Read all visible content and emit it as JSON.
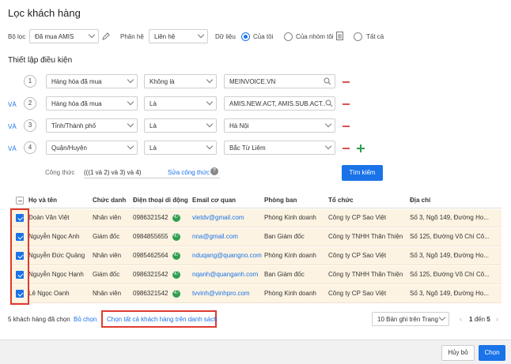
{
  "title": "Lọc khách hàng",
  "filter_row": {
    "filter_label": "Bộ lọc",
    "filter_value": "Đã mua AMIS",
    "module_label": "Phân hệ",
    "module_value": "Liên hệ",
    "data_label": "Dữ liệu",
    "radio_mine": "Của tôi",
    "radio_group": "Của nhóm tôi",
    "radio_all": "Tất cả"
  },
  "conditions_title": "Thiết lập điều kiện",
  "conditions": [
    {
      "num": "1",
      "join": "",
      "field": "Hàng hóa đã mua",
      "op": "Không là",
      "value": "MEINVOICE.VN"
    },
    {
      "num": "2",
      "join": "VÀ",
      "field": "Hàng hóa đã mua",
      "op": "Là",
      "value": "AMIS.NEW.ACT, AMIS.SUB.ACT..."
    },
    {
      "num": "3",
      "join": "VÀ",
      "field": "Tỉnh/Thành phố",
      "op": "Là",
      "value": "Hà Nội"
    },
    {
      "num": "4",
      "join": "VÀ",
      "field": "Quận/Huyện",
      "op": "Là",
      "value": "Bắc Từ Liêm"
    }
  ],
  "formula": {
    "label": "Công thức",
    "value": "(((1 và 2) và 3) và 4)",
    "edit_link": "Sửa công thức",
    "help": "?"
  },
  "search_button": "Tìm kiếm",
  "table": {
    "headers": [
      "Họ và tên",
      "Chức danh",
      "Điện thoại di động",
      "Email cơ quan",
      "Phòng ban",
      "Tổ chức",
      "Địa chỉ"
    ],
    "rows": [
      {
        "name": "Đoàn Văn Việt",
        "title": "Nhân viên",
        "phone": "0986321542",
        "email": "vietdv@gmail.com",
        "dept": "Phòng Kinh doanh",
        "org": "Công ty CP Sao Việt",
        "address": "Số 3, Ngõ 149, Đường Ho..."
      },
      {
        "name": "Nguyễn Ngọc Anh",
        "title": "Giám đốc",
        "phone": "0984855655",
        "email": "nna@gmail.com",
        "dept": "Ban Giám đốc",
        "org": "Công ty TNHH Thăn Thiện",
        "address": "Số 125, Đường Võ Chí Cô..."
      },
      {
        "name": "Nguyễn Đức Quảng",
        "title": "Nhân viên",
        "phone": "0985462564",
        "email": "nduqang@quangno.com",
        "dept": "Phòng Kinh doanh",
        "org": "Công ty CP Sao Việt",
        "address": "Số 3, Ngõ 149, Đường Ho..."
      },
      {
        "name": "Nguyễn Ngọc Hạnh",
        "title": "Giám đốc",
        "phone": "0986321542",
        "email": "nqanh@quanganh.com",
        "dept": "Ban Giám đốc",
        "org": "Công ty TNHH Thăn Thiện",
        "address": "Số 125, Đường Võ Chí Cô..."
      },
      {
        "name": "Lê Ngọc Oanh",
        "title": "Nhân viên",
        "phone": "0986321542",
        "email": "tvvinh@vinhpro.com",
        "dept": "Phòng Kinh doanh",
        "org": "Công ty CP Sao Việt",
        "address": "Số 3, Ngõ 149, Đường Ho..."
      }
    ]
  },
  "bottom": {
    "selected_count": "5 khách hàng đã chọn",
    "deselect": "Bỏ chọn",
    "select_all": "Chọn tất cả khách hàng trên danh sách",
    "page_size": "10 Bản ghi trên Trang",
    "page_range_prefix": "1",
    "page_range_mid": "đến",
    "page_range_total": "5"
  },
  "footer": {
    "cancel": "Hủy bỏ",
    "choose": "Chọn"
  },
  "colors": {
    "accent": "#1a73e8",
    "highlight_row": "#fdf3e2",
    "annotation": "#e03a2f"
  }
}
